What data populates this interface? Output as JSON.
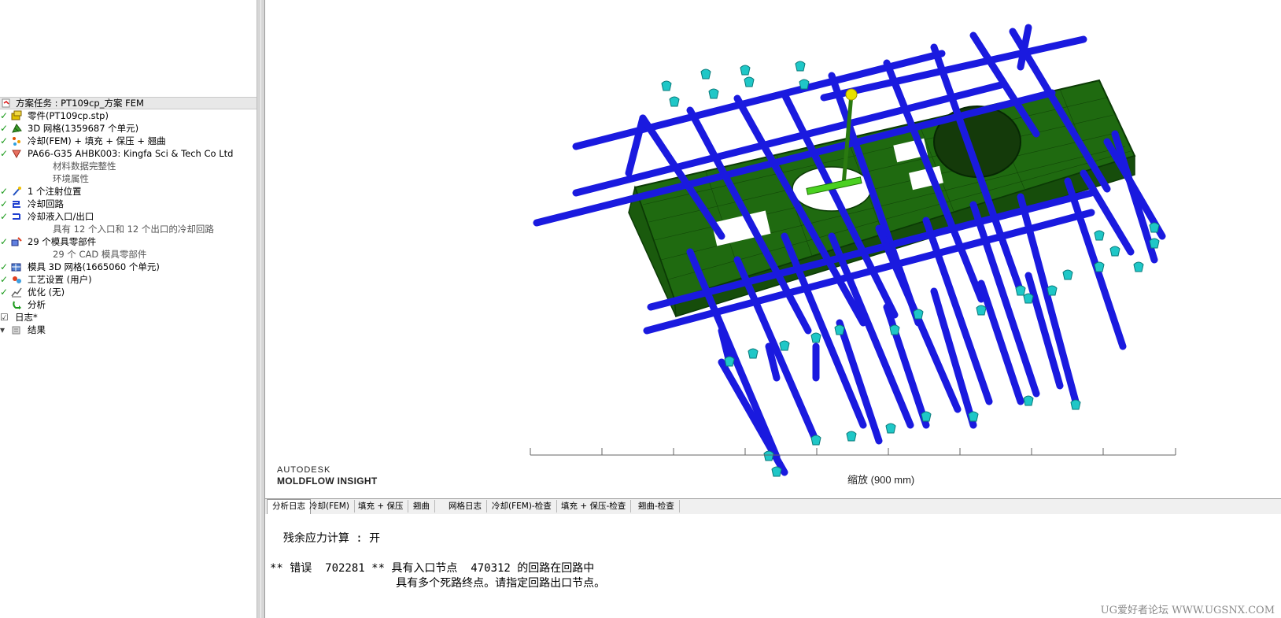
{
  "tree": {
    "header": "方案任务 : PT109cp_方案 FEM",
    "items": [
      {
        "check": "✓",
        "icon": "part",
        "label": "零件(PT109cp.stp)",
        "indent": 0
      },
      {
        "check": "✓",
        "icon": "mesh",
        "label": "3D 网格(1359687 个单元)",
        "indent": 0
      },
      {
        "check": "✓",
        "icon": "sequence",
        "label": "冷却(FEM) + 填充 + 保压 + 翘曲",
        "indent": 0
      },
      {
        "check": "✓",
        "icon": "material",
        "label": "PA66-G35 AHBK003: Kingfa Sci & Tech Co Ltd",
        "indent": 0
      },
      {
        "check": "",
        "icon": "",
        "label": "材料数据完整性",
        "indent": 1
      },
      {
        "check": "",
        "icon": "",
        "label": "环境属性",
        "indent": 1
      },
      {
        "check": "✓",
        "icon": "injection",
        "label": "1 个注射位置",
        "indent": 0
      },
      {
        "check": "✓",
        "icon": "circuit",
        "label": "冷却回路",
        "indent": 0
      },
      {
        "check": "✓",
        "icon": "coolant",
        "label": "冷却液入口/出口",
        "indent": 0
      },
      {
        "check": "",
        "icon": "",
        "label": "具有 12 个入口和 12 个出口的冷却回路",
        "indent": 1
      },
      {
        "check": "✓",
        "icon": "parts",
        "label": "29 个模具零部件",
        "indent": 0
      },
      {
        "check": "",
        "icon": "",
        "label": "29 个 CAD 模具零部件",
        "indent": 1
      },
      {
        "check": "✓",
        "icon": "moldmesh",
        "label": "模具 3D 网格(1665060 个单元)",
        "indent": 0
      },
      {
        "check": "✓",
        "icon": "process",
        "label": "工艺设置 (用户)",
        "indent": 0
      },
      {
        "check": "✓",
        "icon": "optimize",
        "label": "优化 (无)",
        "indent": 0
      },
      {
        "check": "",
        "icon": "analysis",
        "label": "分析",
        "indent": 0
      },
      {
        "check": "☑",
        "icon": "",
        "label": "日志*",
        "indent": 0
      },
      {
        "check": "▾",
        "icon": "results",
        "label": "结果",
        "indent": 0
      }
    ]
  },
  "viewport": {
    "brand_line1": "AUTODESK",
    "brand_line2": "MOLDFLOW INSIGHT",
    "scale_label": "缩放 (900 mm)"
  },
  "log_tabs": [
    "分析日志",
    "冷却(FEM)",
    "填充 + 保压",
    "翘曲",
    "网格日志",
    "冷却(FEM)-检查",
    "填充 + 保压-检查",
    "翘曲-检查"
  ],
  "log_lines": [
    "  残余应力计算 : 开",
    "** 错误  702281 ** 具有入口节点  470312 的回路在回路中",
    "                   具有多个死路终点。请指定回路出口节点。"
  ],
  "watermark": "UG爱好者论坛 WWW.UGSNX.COM",
  "colors": {
    "channel": "#1a1adf",
    "channel_dark": "#0a0a8a",
    "part_mesh": "#1f6a10",
    "coolant_arrow": "#1fc7c7",
    "injection_marker": "#e8e000",
    "check_green": "#1a9a1a"
  }
}
